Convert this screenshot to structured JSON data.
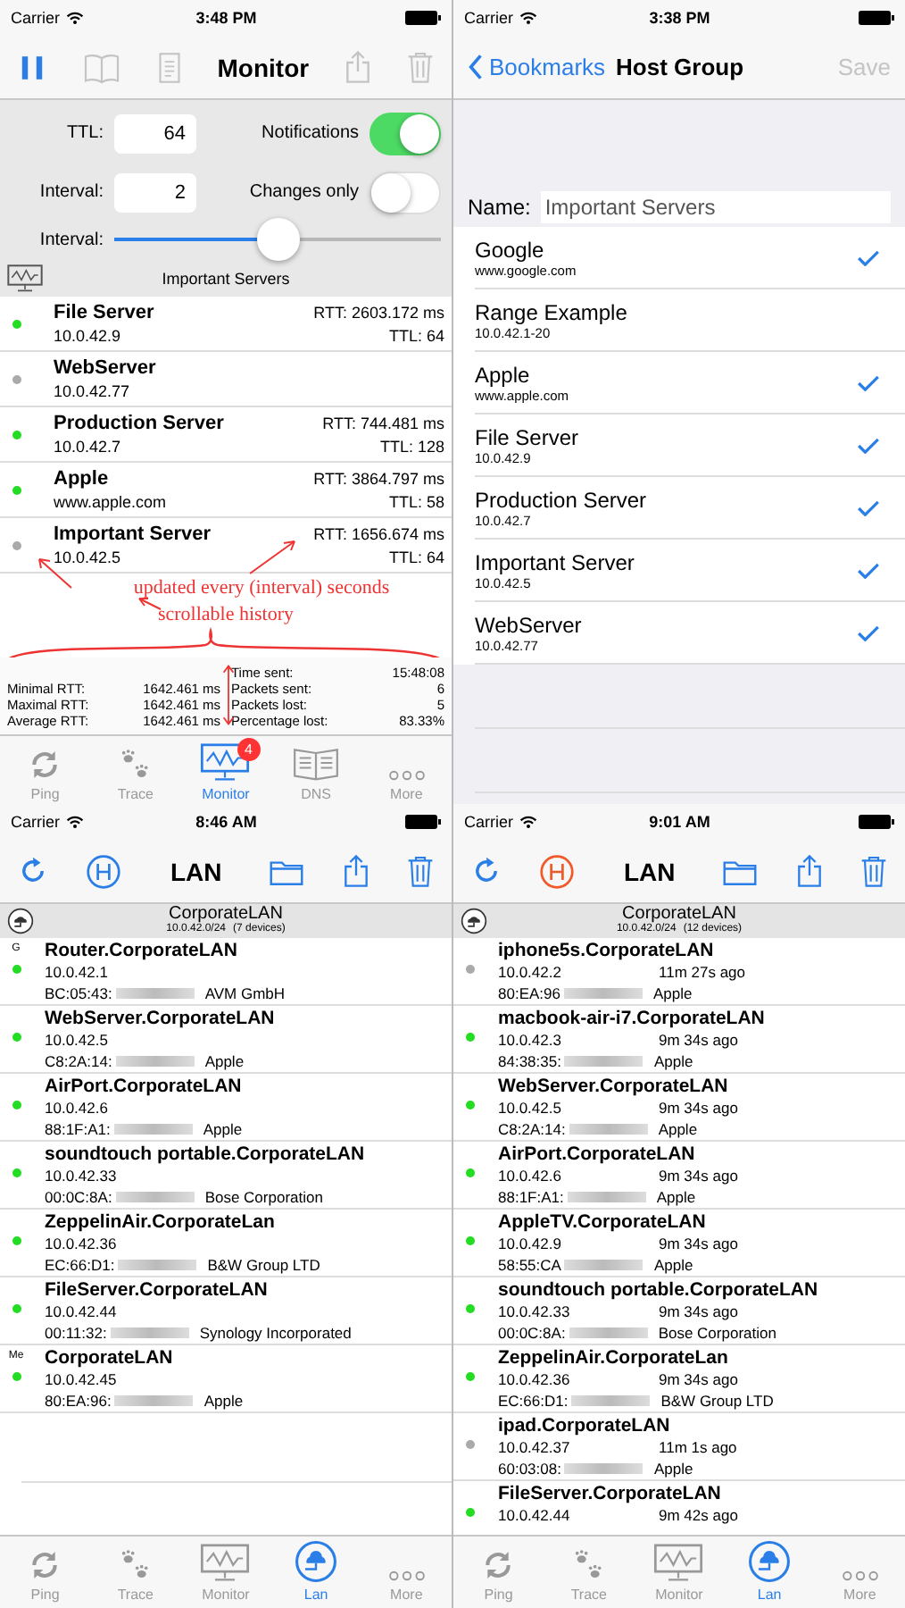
{
  "monitor_screen": {
    "status_bar": {
      "carrier": "Carrier",
      "time": "3:48 PM"
    },
    "toolbar": {
      "title": "Monitor",
      "buttons": [
        {
          "kind": "pause",
          "disabled": false
        },
        {
          "kind": "book",
          "disabled": true
        },
        {
          "kind": "document",
          "disabled": true
        },
        {
          "kind": "title"
        },
        {
          "kind": "share",
          "disabled": true
        },
        {
          "kind": "trash",
          "disabled": true
        }
      ]
    },
    "settings": {
      "ttl_label": "TTL:",
      "ttl_value": "64",
      "interval_label": "Interval:",
      "interval_value": "2",
      "notifications": {
        "label": "Notifications",
        "on": true
      },
      "changes_only": {
        "label": "Changes only",
        "on": false
      },
      "slider": {
        "label": "Interval:",
        "level": 0.5
      }
    },
    "group": {
      "title": "Important Servers"
    },
    "hosts": [
      {
        "name": "File Server",
        "address": "10.0.42.9",
        "rtt": "RTT: 2603.172 ms",
        "ttl": "TTL: 64",
        "color": "#22dd22"
      },
      {
        "name": "WebServer",
        "address": "10.0.42.77",
        "color": "#aaaaaa"
      },
      {
        "name": "Production Server",
        "address": "10.0.42.7",
        "rtt": "RTT: 744.481 ms",
        "ttl": "TTL: 128",
        "color": "#22dd22"
      },
      {
        "name": "Apple",
        "address": "www.apple.com",
        "rtt": "RTT: 3864.797 ms",
        "ttl": "TTL: 58",
        "color": "#22dd22"
      },
      {
        "name": "Important Server",
        "address": "10.0.42.5",
        "rtt": "RTT: 1656.674 ms",
        "ttl": "TTL: 64",
        "color": "#aaaaaa"
      }
    ],
    "annotations": [
      "updated every (interval) seconds",
      "scrollable history"
    ],
    "stats": {
      "left": [
        {
          "label": "Minimal RTT:",
          "value": "1642.461 ms"
        },
        {
          "label": "Maximal RTT:",
          "value": "1642.461 ms"
        },
        {
          "label": "Average RTT:",
          "value": "1642.461 ms"
        }
      ],
      "right": [
        {
          "label": "Time sent:",
          "value": "15:48:08"
        },
        {
          "label": "Packets sent:",
          "value": "6"
        },
        {
          "label": "Packets lost:",
          "value": "5"
        },
        {
          "label": "Percentage lost:",
          "value": "83.33%"
        }
      ]
    },
    "tab_bar": [
      {
        "kind": "ping",
        "label": "Ping",
        "selected": false
      },
      {
        "kind": "trace",
        "label": "Trace",
        "selected": false
      },
      {
        "kind": "monitor",
        "label": "Monitor",
        "selected": true,
        "badge": "4"
      },
      {
        "kind": "dns",
        "label": "DNS",
        "selected": false
      },
      {
        "kind": "more",
        "label": "More",
        "selected": false
      }
    ]
  },
  "host_group_screen": {
    "status_bar": {
      "carrier": "Carrier",
      "time": "3:38 PM"
    },
    "nav": {
      "back": "Bookmarks",
      "title": "Host Group",
      "save": {
        "label": "Save",
        "disabled": true
      }
    },
    "name_field": {
      "label": "Name:",
      "value": "Important Servers"
    },
    "hosts": [
      {
        "name": "Google",
        "detail": "www.google.com",
        "checked": true
      },
      {
        "name": "Range Example",
        "detail": "10.0.42.1-20",
        "checked": false
      },
      {
        "name": "Apple",
        "detail": "www.apple.com",
        "checked": true
      },
      {
        "name": "File Server",
        "detail": "10.0.42.9",
        "checked": true
      },
      {
        "name": "Production Server",
        "detail": "10.0.42.7",
        "checked": true
      },
      {
        "name": "Important Server",
        "detail": "10.0.42.5",
        "checked": true
      },
      {
        "name": "WebServer",
        "detail": "10.0.42.77",
        "checked": true
      }
    ]
  },
  "lan_screens": [
    {
      "status_bar": {
        "carrier": "Carrier",
        "time": "8:46 AM"
      },
      "toolbar": {
        "title": "LAN",
        "history_on": false
      },
      "network": {
        "name": "CorporateLAN",
        "subnet": "10.0.42.0/24",
        "count": "(7 devices)"
      },
      "devices": [
        {
          "tag": "G",
          "name": "Router.CorporateLAN",
          "address": "10.0.42.1",
          "mac": "BC:05:43:",
          "vendor": "AVM GmbH",
          "color": "#22dd22"
        },
        {
          "name": "WebServer.CorporateLAN",
          "address": "10.0.42.5",
          "mac": "C8:2A:14:",
          "vendor": "Apple",
          "color": "#22dd22"
        },
        {
          "name": "AirPort.CorporateLAN",
          "address": "10.0.42.6",
          "mac": "88:1F:A1:",
          "vendor": "Apple",
          "color": "#22dd22"
        },
        {
          "name": "soundtouch portable.CorporateLAN",
          "address": "10.0.42.33",
          "mac": "00:0C:8A:",
          "vendor": "Bose Corporation",
          "color": "#22dd22"
        },
        {
          "name": "ZeppelinAir.CorporateLan",
          "address": "10.0.42.36",
          "mac": "EC:66:D1:",
          "vendor": "B&W Group LTD",
          "color": "#22dd22"
        },
        {
          "name": "FileServer.CorporateLAN",
          "address": "10.0.42.44",
          "mac": "00:11:32:",
          "vendor": "Synology Incorporated",
          "color": "#22dd22"
        },
        {
          "tag": "Me",
          "name": "CorporateLAN",
          "address": "10.0.42.45",
          "mac": "80:EA:96:",
          "vendor": "Apple",
          "color": "#22dd22"
        }
      ],
      "tab_bar": [
        {
          "kind": "ping",
          "label": "Ping",
          "selected": false
        },
        {
          "kind": "trace",
          "label": "Trace",
          "selected": false
        },
        {
          "kind": "monitor",
          "label": "Monitor",
          "selected": false
        },
        {
          "kind": "lan",
          "label": "Lan",
          "selected": true
        },
        {
          "kind": "more",
          "label": "More",
          "selected": false
        }
      ]
    },
    {
      "status_bar": {
        "carrier": "Carrier",
        "time": "9:01 AM"
      },
      "toolbar": {
        "title": "LAN",
        "history_on": true
      },
      "network": {
        "name": "CorporateLAN",
        "subnet": "10.0.42.0/24",
        "count": "(12 devices)"
      },
      "devices": [
        {
          "name": "iphone5s.CorporateLAN",
          "address": "10.0.42.2",
          "seen": "11m 27s ago",
          "mac": "80:EA:96",
          "vendor": "Apple",
          "color": "#aaaaaa"
        },
        {
          "name": "macbook-air-i7.CorporateLAN",
          "address": "10.0.42.3",
          "seen": "9m 34s ago",
          "mac": "84:38:35:",
          "vendor": "Apple",
          "color": "#22dd22"
        },
        {
          "name": "WebServer.CorporateLAN",
          "address": "10.0.42.5",
          "seen": "9m 34s ago",
          "mac": "C8:2A:14:",
          "vendor": "Apple",
          "color": "#22dd22"
        },
        {
          "name": "AirPort.CorporateLAN",
          "address": "10.0.42.6",
          "seen": "9m 34s ago",
          "mac": "88:1F:A1:",
          "vendor": "Apple",
          "color": "#22dd22"
        },
        {
          "name": "AppleTV.CorporateLAN",
          "address": "10.0.42.9",
          "seen": "9m 34s ago",
          "mac": "58:55:CA",
          "vendor": "Apple",
          "color": "#22dd22"
        },
        {
          "name": "soundtouch portable.CorporateLAN",
          "address": "10.0.42.33",
          "seen": "9m 34s ago",
          "mac": "00:0C:8A:",
          "vendor": "Bose Corporation",
          "color": "#22dd22"
        },
        {
          "name": "ZeppelinAir.CorporateLan",
          "address": "10.0.42.36",
          "seen": "9m 34s ago",
          "mac": "EC:66:D1:",
          "vendor": "B&W Group LTD",
          "color": "#22dd22"
        },
        {
          "name": "ipad.CorporateLAN",
          "address": "10.0.42.37",
          "seen": "11m 1s ago",
          "mac": "60:03:08:",
          "vendor": "Apple",
          "color": "#aaaaaa"
        },
        {
          "name": "FileServer.CorporateLAN",
          "address": "10.0.42.44",
          "seen": "9m 42s ago",
          "color": "#22dd22"
        }
      ],
      "tab_bar": [
        {
          "kind": "ping",
          "label": "Ping",
          "selected": false
        },
        {
          "kind": "trace",
          "label": "Trace",
          "selected": false
        },
        {
          "kind": "monitor",
          "label": "Monitor",
          "selected": false
        },
        {
          "kind": "lan",
          "label": "Lan",
          "selected": true
        },
        {
          "kind": "more",
          "label": "More",
          "selected": false
        }
      ]
    }
  ]
}
